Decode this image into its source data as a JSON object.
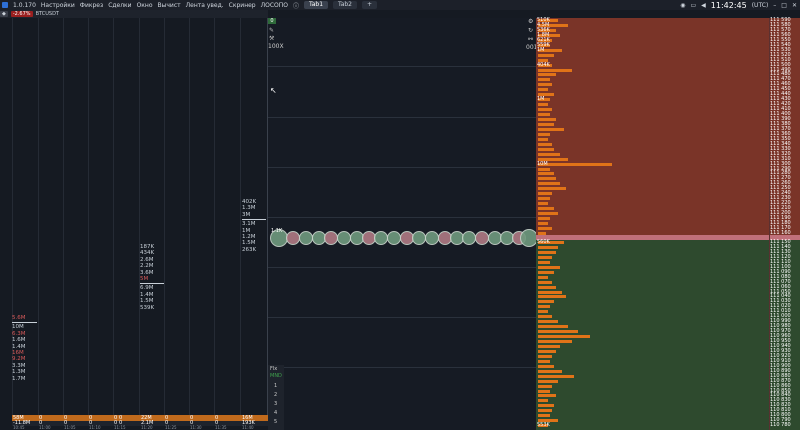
{
  "app": {
    "version": "1.0.170",
    "logo_color": "#2e6fd6"
  },
  "menu": [
    "Настройки",
    "Фикрез",
    "Сделки",
    "Окно",
    "Вычист",
    "Лента увед.",
    "Скринер",
    "ЛОСОПО"
  ],
  "tabs": [
    {
      "label": "Tab1",
      "active": true
    },
    {
      "label": "Tab2",
      "active": false
    }
  ],
  "add_tab": "+",
  "clock": "11:42:45",
  "timezone": "(UTC)",
  "symbol": {
    "change": "-2.67%",
    "name": "BTCUSDT"
  },
  "clusters": {
    "c1": [
      "5.6M",
      "10M",
      "6.3M",
      "1.6M",
      "1.4M",
      "16M",
      "9.2M",
      "3.3M",
      "1.3M",
      "1.7M"
    ],
    "c2": [
      "187K",
      "434K",
      "2.6M",
      "2.2M",
      "3.6M",
      "5M",
      "6.9M",
      "1.4M",
      "1.5M",
      "539K"
    ],
    "c3": [
      "402K",
      "1.3M",
      "3M",
      "3.1M",
      "1M",
      "1.2M",
      "1.5M",
      "263K"
    ]
  },
  "bottom": {
    "row1": [
      "58M",
      "0",
      "0",
      "0",
      "0",
      "0",
      "22M",
      "0",
      "0",
      "0",
      "16M"
    ],
    "row2": [
      "-11.8M",
      "0",
      "0",
      "0",
      "0",
      "0",
      "2.1M",
      "0",
      "0",
      "0",
      "193K"
    ],
    "times": [
      "10:45",
      "11:00",
      "11:05",
      "11:10",
      "11:15",
      "11:20",
      "11:25",
      "11:30",
      "11:35",
      "11:40"
    ]
  },
  "chart": {
    "zoom": "100X",
    "top_value": "0",
    "corner": "001",
    "left_label": "1.1K",
    "flx_label": "Flx",
    "flx_mode": "MND",
    "flx_levels": [
      "1",
      "2",
      "3",
      "4",
      "5"
    ]
  },
  "ladder": {
    "ask_prices": [
      "111 590",
      "111 580",
      "111 570",
      "111 560",
      "111 550",
      "111 540",
      "111 530",
      "111 520",
      "111 510",
      "111 500",
      "111 490",
      "111 480",
      "111 470",
      "111 460",
      "111 450",
      "111 440",
      "111 430",
      "111 420",
      "111 410",
      "111 400",
      "111 390",
      "111 380",
      "111 370",
      "111 360",
      "111 350",
      "111 340",
      "111 330",
      "111 320",
      "111 310",
      "111 300",
      "111 290",
      "111 280",
      "111 270",
      "111 260",
      "111 250",
      "111 240",
      "111 230",
      "111 220",
      "111 210",
      "111 200",
      "111 190",
      "111 180",
      "111 170",
      "111 160"
    ],
    "bid_prices": [
      "111 150",
      "111 140",
      "111 130",
      "111 120",
      "111 110",
      "111 100",
      "111 090",
      "111 080",
      "111 070",
      "111 060",
      "111 050",
      "111 040",
      "111 030",
      "111 020",
      "111 010",
      "111 000",
      "110 990",
      "110 980",
      "110 970",
      "110 960",
      "110 950",
      "110 940",
      "110 930",
      "110 920",
      "110 910",
      "110 900",
      "110 890",
      "110 880",
      "110 870",
      "110 860",
      "110 850",
      "110 840",
      "110 830",
      "110 820",
      "110 810",
      "110 800",
      "110 790",
      "110 780"
    ],
    "ask_labels": [
      "510K",
      "4.5M",
      "536K",
      "1.8M",
      "621K",
      "559K",
      "1M",
      "",
      "",
      "404K",
      "",
      "",
      "",
      "",
      "",
      "",
      "1M",
      "",
      "",
      "",
      "",
      "",
      "",
      "",
      "",
      "",
      "",
      "",
      "",
      "10M",
      "",
      "",
      "",
      "",
      "",
      "",
      "",
      "",
      "",
      "",
      "",
      "",
      "",
      ""
    ],
    "bid_labels": [
      "560K",
      "",
      "",
      "",
      "",
      "",
      "",
      "",
      "",
      "",
      "",
      "",
      "",
      "",
      "",
      "",
      "",
      "",
      "",
      "",
      "",
      "",
      "",
      "",
      "",
      "",
      "",
      "",
      "",
      "",
      "",
      "",
      "",
      "",
      "",
      "",
      "",
      "553K",
      "",
      "481K",
      "1.4M"
    ],
    "colors": {
      "ask_bg": "#7a3428",
      "bid_bg": "#2e4a2e",
      "volume": "#e07318"
    }
  }
}
